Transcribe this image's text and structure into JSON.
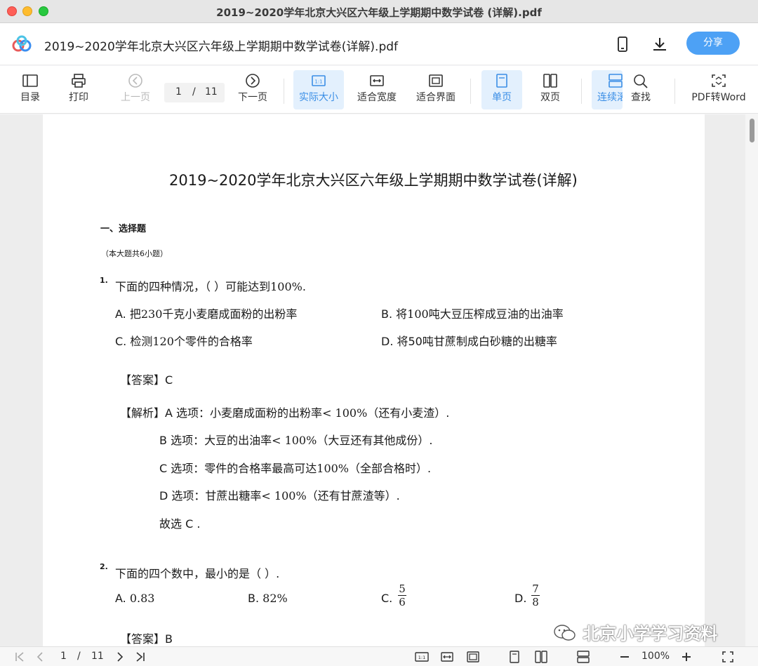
{
  "window": {
    "title": "2019~2020学年北京大兴区六年级上学期期中数学试卷 (详解).pdf"
  },
  "header": {
    "doc_title": "2019~2020学年北京大兴区六年级上学期期中数学试卷(详解).pdf",
    "share_label": "分享"
  },
  "toolbar": {
    "toc": "目录",
    "print": "打印",
    "prev": "上一页",
    "page_current": "1",
    "page_sep": "/",
    "page_total": "11",
    "next": "下一页",
    "actual_size": "实际大小",
    "fit_width": "适合宽度",
    "fit_page": "适合界面",
    "single": "单页",
    "double": "双页",
    "continuous": "连续滚",
    "find": "查找",
    "pdf2word": "PDF转Word"
  },
  "document": {
    "title": "2019~2020学年北京大兴区六年级上学期期中数学试卷(详解)",
    "section": "一、选择题",
    "section_note": "（本大题共6小题）",
    "q1": {
      "num": "1.",
      "text_a": "下面的四种情况，（   ）可能达到",
      "text_b": "100%",
      "text_c": ".",
      "a_pre": "A. 把",
      "a_num": "230",
      "a_post": "千克小麦磨成面粉的出粉率",
      "b_pre": "B. 将",
      "b_num": "100",
      "b_post": "吨大豆压榨成豆油的出油率",
      "c_pre": "C. 检测",
      "c_num": "120",
      "c_post": "个零件的合格率",
      "d": "D. 将50吨甘蔗制成白砂糖的出糖率",
      "answer_label": "【答案】",
      "answer": "C",
      "analysis_label": "【解析】",
      "line1_a": "A 选项：小麦磨成面粉的出粉率",
      "line1_b": "< 100%",
      "line1_c": "（还有小麦渣）.",
      "line2_a": "B 选项：大豆的出油率",
      "line2_b": "< 100%",
      "line2_c": "（大豆还有其他成份）.",
      "line3_a": "C 选项：零件的合格率最高可达",
      "line3_b": "100%",
      "line3_c": "（全部合格时）.",
      "line4_a": "D 选项：甘蔗出糖率",
      "line4_b": "< 100%",
      "line4_c": "（还有甘蔗渣等）.",
      "line5": "故选 C ."
    },
    "q2": {
      "num": "2.",
      "text": "下面的四个数中，最小的是（   ）.",
      "a_label": "A.",
      "a_val": "0.83",
      "b_label": "B.",
      "b_val": "82%",
      "c_label": "C.",
      "c_num": "5",
      "c_den": "6",
      "d_label": "D.",
      "d_num": "7",
      "d_den": "8",
      "answer_label": "【答案】",
      "answer": "B"
    },
    "watermark": "北京小学学习资料"
  },
  "bottombar": {
    "page_current": "1",
    "page_sep": "/",
    "page_total": "11",
    "zoom": "100%"
  },
  "colors": {
    "accent": "#4da1f5",
    "active_bg": "#e3f0fd",
    "active_text": "#3a8ee6"
  }
}
